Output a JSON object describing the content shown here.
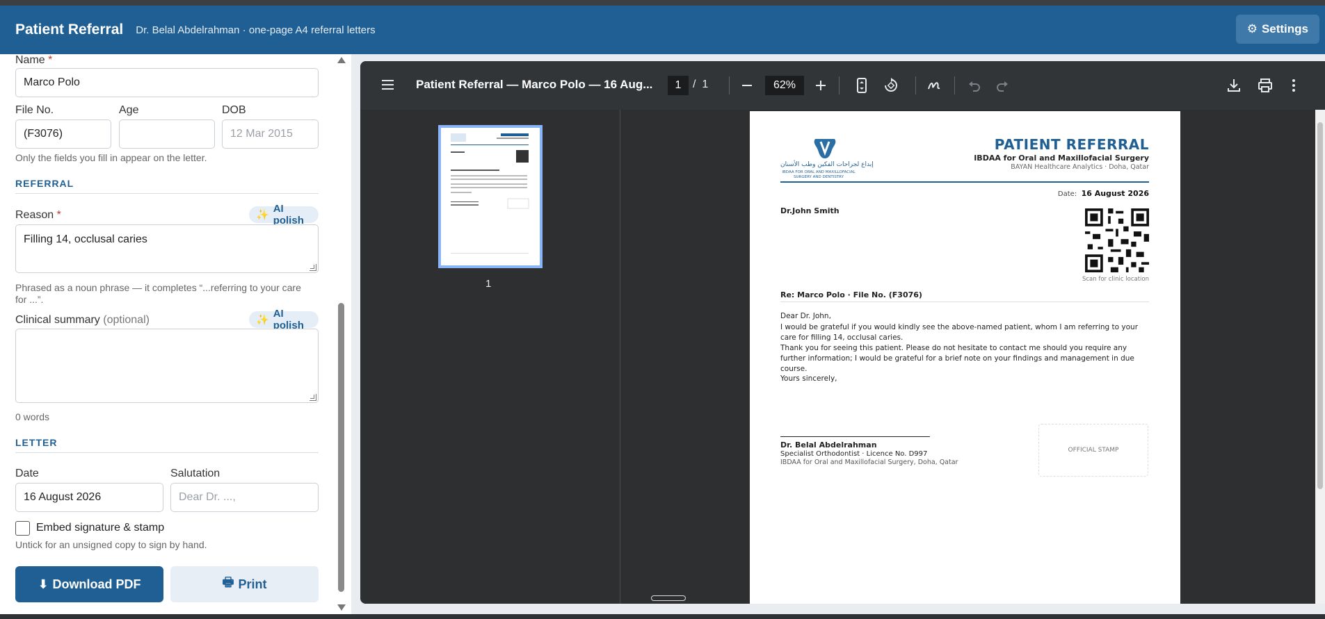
{
  "header": {
    "title": "Patient Referral",
    "subtitle": "Dr. Belal Abdelrahman · one-page A4 referral letters",
    "settings_label": "Settings"
  },
  "form": {
    "name_label": "Name",
    "name_required": "*",
    "name_value": "Marco Polo",
    "file_label": "File No.",
    "file_value": "(F3076)",
    "age_label": "Age",
    "age_value": "",
    "dob_label": "DOB",
    "dob_placeholder": "12 Mar 2015",
    "fields_hint": "Only the fields you fill in appear on the letter.",
    "referral_section": "REFERRAL",
    "reason_label": "Reason",
    "reason_required": "*",
    "reason_value": "Filling 14, occlusal caries",
    "ai_polish_label": "AI polish",
    "reason_hint": "Phrased as a noun phrase — it completes “...referring to your care for ...”.",
    "summary_label": "Clinical summary",
    "summary_optional": "(optional)",
    "summary_value": "",
    "word_count": "0 words",
    "letter_section": "LETTER",
    "date_label": "Date",
    "date_value": "16 August 2026",
    "salutation_label": "Salutation",
    "salutation_placeholder": "Dear Dr. ...,",
    "embed_label": "Embed signature & stamp",
    "embed_checked": false,
    "embed_hint": "Untick for an unsigned copy to sign by hand.",
    "download_label": "Download PDF",
    "print_label": "Print"
  },
  "viewer": {
    "doc_title": "Patient Referral — Marco Polo — 16 Aug...",
    "current_page": "1",
    "page_separator": "/",
    "total_pages": "1",
    "zoom": "62%",
    "thumb_page_number": "1"
  },
  "letter": {
    "title": "PATIENT REFERRAL",
    "org": "IBDAA for Oral and Maxillofacial Surgery",
    "org_sub": "BAYAN Healthcare Analytics · Doha, Qatar",
    "logo_ar": "إبداع لجراحات الفكين وطب الأسنان",
    "logo_en": "IBDAA FOR ORAL AND MAXILLOFACIAL SURGERY AND DENTISTRY",
    "date_label": "Date:",
    "date_value": "16 August 2026",
    "recipient": "Dr.John Smith",
    "scan_label": "Scan for clinic location",
    "re_line": "Re:   Marco Polo  ·  File No. (F3076)",
    "greeting": "Dear Dr. John,",
    "para1": "I would be grateful if you would kindly see the above-named patient, whom I am referring to your care for filling 14, occlusal caries.",
    "para2": "Thank you for seeing this patient. Please do not hesitate to contact me should you require any further information; I would be grateful for a brief note on your findings and management in due course.",
    "closing": "Yours sincerely,",
    "sig_name": "Dr. Belal Abdelrahman",
    "sig_title": "Specialist Orthodontist  ·  Licence No. D997",
    "sig_org": "IBDAA for Oral and Maxillofacial Surgery, Doha, Qatar",
    "stamp_label": "OFFICIAL STAMP"
  },
  "colors": {
    "brand": "#1f5f94",
    "viewer_bg": "#2d2f31"
  }
}
